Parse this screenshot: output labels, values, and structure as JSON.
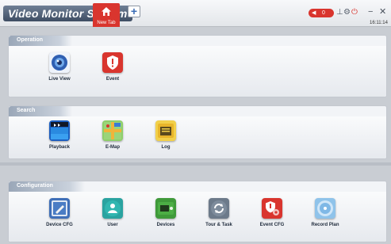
{
  "titlebar": {
    "app_title": "Video Monitor System",
    "active_tab_label": "New Tab",
    "add_tab_symbol": "+",
    "alarm_count": "0",
    "clock": "16:11:14",
    "minimize_symbol": "−",
    "close_symbol": "✕"
  },
  "sections": {
    "operation": {
      "title": "Operation",
      "items": [
        {
          "label": "Live View",
          "icon": "live-view-icon"
        },
        {
          "label": "Event",
          "icon": "event-icon"
        }
      ]
    },
    "search": {
      "title": "Search",
      "items": [
        {
          "label": "Playback",
          "icon": "playback-icon"
        },
        {
          "label": "E-Map",
          "icon": "emap-icon"
        },
        {
          "label": "Log",
          "icon": "log-icon"
        }
      ]
    },
    "configuration": {
      "title": "Configuration",
      "items": [
        {
          "label": "Device CFG",
          "icon": "device-cfg-icon"
        },
        {
          "label": "User",
          "icon": "user-icon"
        },
        {
          "label": "Devices",
          "icon": "devices-icon"
        },
        {
          "label": "Tour & Task",
          "icon": "tour-task-icon"
        },
        {
          "label": "Event CFG",
          "icon": "event-cfg-icon"
        },
        {
          "label": "Record Plan",
          "icon": "record-plan-icon"
        }
      ]
    }
  },
  "colors": {
    "accent_red": "#d9352e",
    "header_blue": "#9aa7b8",
    "background": "#c9cdd3"
  }
}
